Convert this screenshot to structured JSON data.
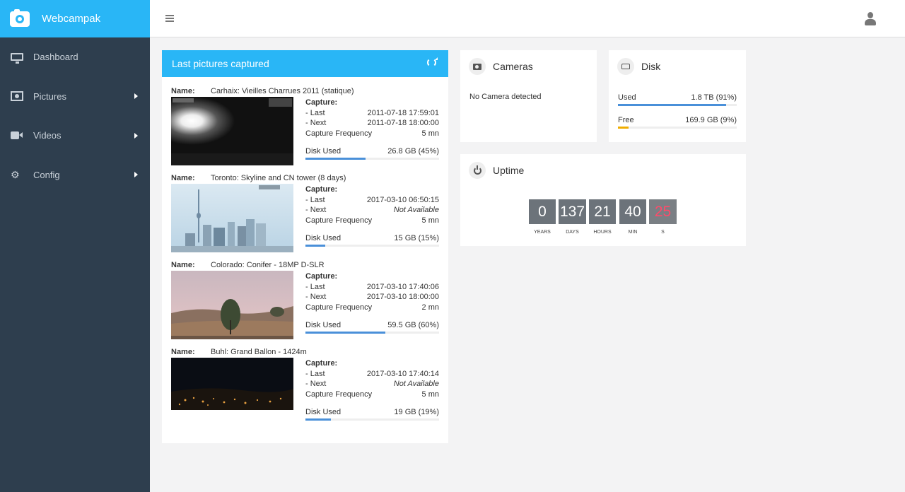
{
  "brand": {
    "name": "Webcampak"
  },
  "sidebar": {
    "items": [
      {
        "label": "Dashboard",
        "icon": "monitor-icon"
      },
      {
        "label": "Pictures",
        "icon": "picture-icon"
      },
      {
        "label": "Videos",
        "icon": "video-icon"
      },
      {
        "label": "Config",
        "icon": "cogs-icon"
      }
    ]
  },
  "last_pictures": {
    "title": "Last pictures captured",
    "name_label": "Name:",
    "capture_label": "Capture:",
    "last_label": "- Last",
    "next_label": "- Next",
    "freq_label": "Capture Frequency",
    "disk_label": "Disk Used",
    "cameras": [
      {
        "name": "Carhaix: Vieilles Charrues 2011 (statique)",
        "last": "2011-07-18 17:59:01",
        "next": "2011-07-18 18:00:00",
        "frequency": "5 mn",
        "disk": "26.8 GB (45%)",
        "disk_percent": 45,
        "scene": "night-lights"
      },
      {
        "name": "Toronto: Skyline and CN tower (8 days)",
        "last": "2017-03-10 06:50:15",
        "next": "Not Available",
        "frequency": "5 mn",
        "disk": "15 GB (15%)",
        "disk_percent": 15,
        "scene": "skyline"
      },
      {
        "name": "Colorado: Conifer - 18MP D-SLR",
        "last": "2017-03-10 17:40:06",
        "next": "2017-03-10 18:00:00",
        "frequency": "2 mn",
        "disk": "59.5 GB (60%)",
        "disk_percent": 60,
        "scene": "landscape"
      },
      {
        "name": "Buhl: Grand Ballon - 1424m",
        "last": "2017-03-10 17:40:14",
        "next": "Not Available",
        "frequency": "5 mn",
        "disk": "19 GB (19%)",
        "disk_percent": 19,
        "scene": "night-town"
      }
    ]
  },
  "cameras_panel": {
    "title": "Cameras",
    "message": "No Camera detected"
  },
  "disk_panel": {
    "title": "Disk",
    "used_label": "Used",
    "used_value": "1.8 TB (91%)",
    "used_percent": 91,
    "free_label": "Free",
    "free_value": "169.9 GB (9%)",
    "free_percent": 9
  },
  "uptime_panel": {
    "title": "Uptime",
    "years": "0",
    "days": "137",
    "hours": "21",
    "min": "40",
    "sec": "25",
    "years_label": "YEARS",
    "days_label": "DAYS",
    "hours_label": "HOURS",
    "min_label": "MIN",
    "sec_label": "S"
  },
  "colors": {
    "accent": "#29b6f6",
    "sidebar": "#2e3e4e",
    "bar": "#4a90d9",
    "free_bar": "#f0ad00"
  }
}
